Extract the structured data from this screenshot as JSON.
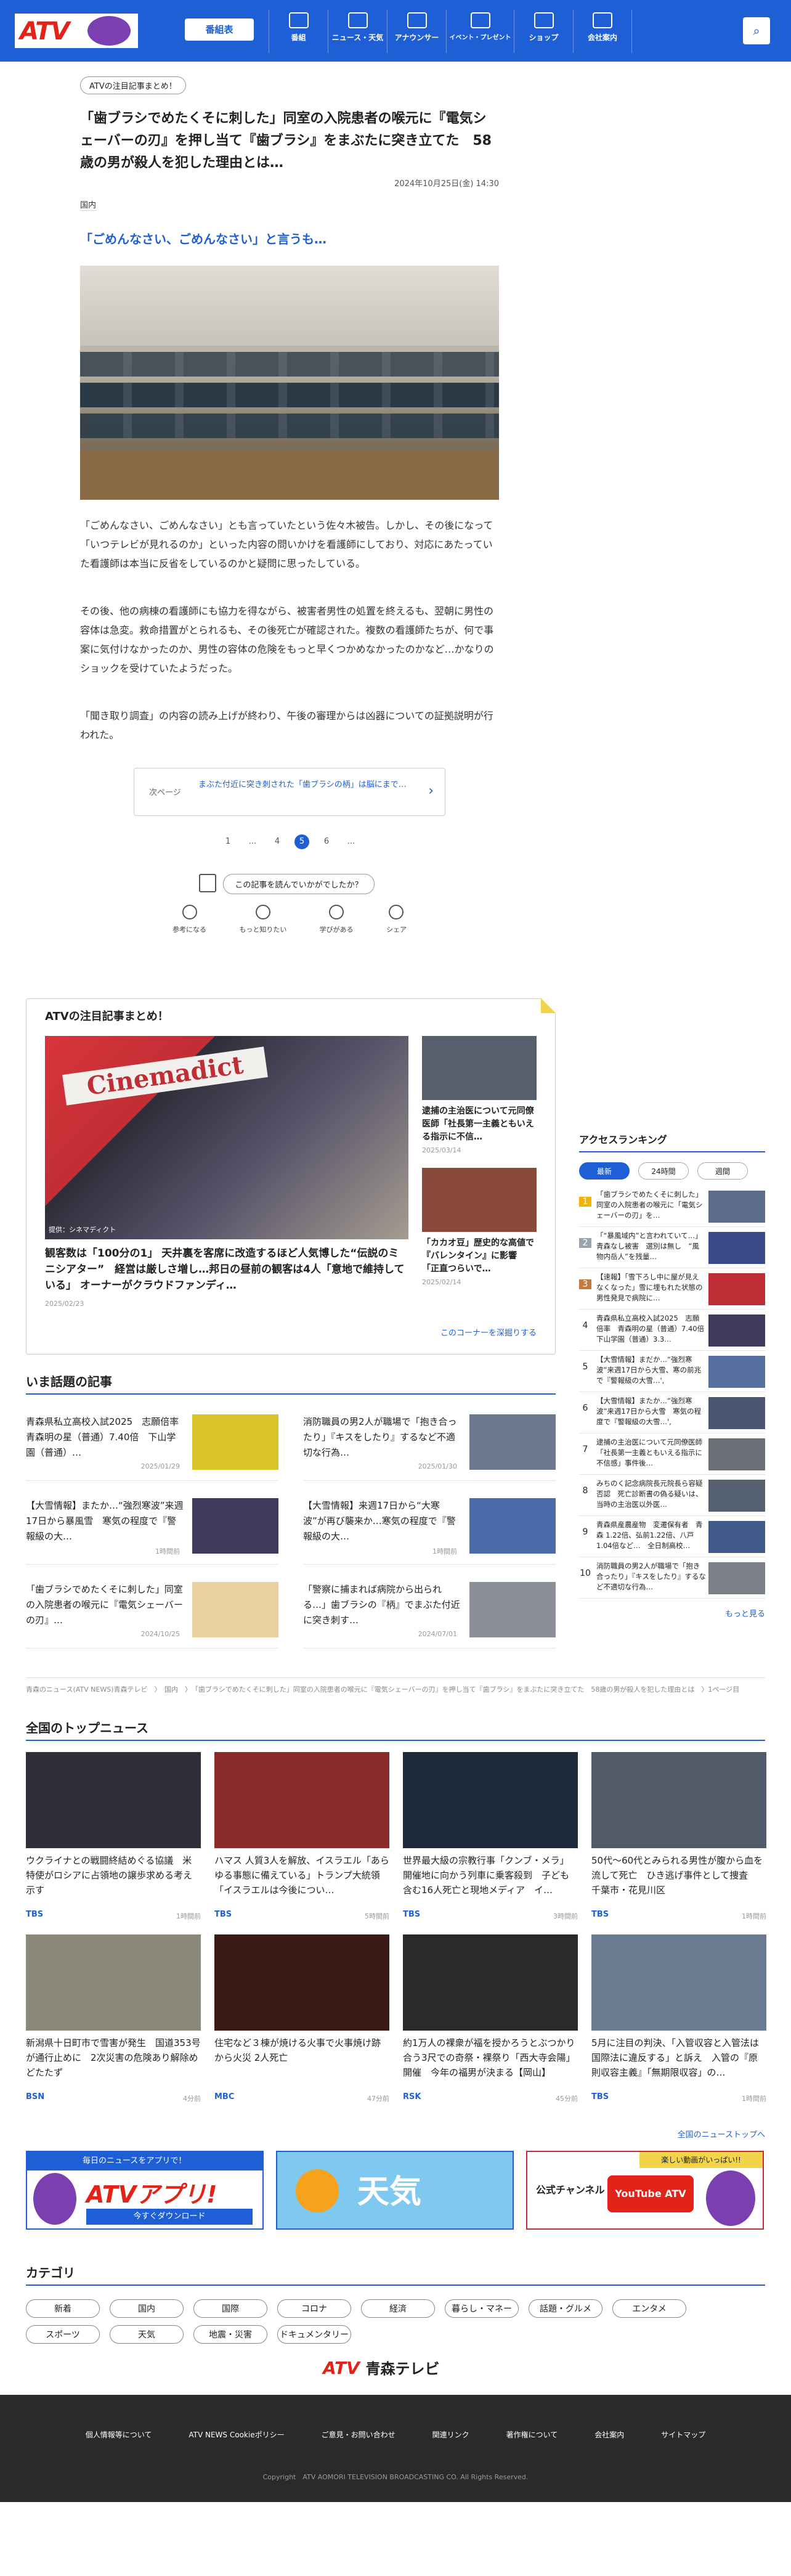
{
  "header": {
    "logo": "ATV",
    "program_label": "番組表",
    "nav": [
      "番組",
      "ニュース・天気",
      "アナウンサー",
      "イベント・プレゼント",
      "ショップ",
      "会社案内"
    ]
  },
  "article": {
    "tag": "ATVの注目記事まとめ！",
    "title": "「歯ブラシでめたくそに刺した」同室の入院患者の喉元に『電気シェーバーの刃』を押し当て『歯ブラシ』をまぶたに突き立てた　58歳の男が殺人を犯した理由とは…",
    "date": "2024年10月25日(金) 14:30",
    "category": "国内",
    "lead": "「ごめんなさい、ごめんなさい」と言うも…",
    "p1": "「ごめんなさい、ごめんなさい」とも言っていたという佐々木被告。しかし、その後になって「いつテレビが見れるのか」といった内容の問いかけを看護師にしており、対応にあたっていた看護師は本当に反省をしているのかと疑問に思ったしている。",
    "p2": "その後、他の病棟の看護師にも協力を得ながら、被害者男性の処置を終えるも、翌朝に男性の容体は急変。救命措置がとられるも、その後死亡が確認された。複数の看護師たちが、何で事案に気付けなかったのか、男性の容体の危険をもっと早くつかめなかったのかなど…かなりのショックを受けていたようだった。",
    "p3": "「聞き取り調査」の内容の読み上げが終わり、午後の審理からは凶器についての証拠説明が行われた。",
    "next_label": "次ページ",
    "next_title": "まぶた付近に突き刺された「歯ブラシの柄」は脳にまで…",
    "pages": [
      "1",
      "…",
      "4",
      "5",
      "6",
      "…"
    ],
    "question": "この記事を読んでいかがでしたか？",
    "reactions": [
      "参考になる",
      "もっと知りたい",
      "学びがある",
      "シェア"
    ]
  },
  "feature": {
    "title": "ATVの注目記事まとめ！",
    "big_caption": "提供：シネマディクト",
    "big_title": "観客数は「100分の1」 天井裏を客席に改造するほど人気博した“伝説のミニシアター”　経営は厳しさ増し…邦日の昼前の観客は4人「意地で維持している」 オーナーがクラウドファンディ…",
    "big_date": "2025/02/23",
    "side": [
      {
        "title": "逮捕の主治医について元同僚医師「社長第一主義ともいえる指示に不信…",
        "date": "2025/03/14"
      },
      {
        "title": "「カカオ豆」歴史的な高値で『バレンタイン』に影響 「正直つらいで…",
        "date": "2025/02/14"
      }
    ],
    "more": "このコーナーを深掘りする"
  },
  "ranking": {
    "title": "アクセスランキング",
    "tabs": [
      "最新",
      "24時間",
      "週間"
    ],
    "items": [
      "「歯ブラシでめたくそに刺した」同室の入院患者の喉元に「電気シェーバーの刃」を…",
      "「“暴風域内”と言われていて…」青森なし被害　選別は無し　“風物内岳人”を残量…",
      "【速報】「雪下ろし中に屋が見えなくなった」雪に埋もれた状態の男性発見で病院に…",
      "青森県私立高校入試2025　志願倍率　青森明の星（普通）7.40倍　下山学園（普通）3.3…",
      "【大雪情報】まだか…“強烈寒波”来週17日から大雪、寒の前兆で『警報級の大雪…',",
      "【大雪情報】またか…“強烈寒波”来週17日から大雪　寒気の程度で『警報級の大雪…',",
      "逮捕の主治医について元同僚医師「社長第一主義ともいえる指示に不信感」事件後…",
      "みちのく記念病院長元院長ら容疑否認　死亡診断書の偽る疑いは、当時の主治医以外医…",
      "青森県産農産物　変遷保有者　青森 1.22倍、弘前1.22倍、八戸1.04倍など…　全日制高校…",
      "消防職員の男2人が職場で「抱き合ったり」『キスをしたり』するなど不適切な行為…"
    ],
    "more": "もっと見る"
  },
  "topics": {
    "title": "いま話題の記事",
    "items": [
      {
        "title": "青森県私立高校入試2025　志願倍率　青森明の星（普通）7.40倍　下山学園（普通）…",
        "date": "2025/01/29"
      },
      {
        "title": "消防職員の男2人が職場で「抱き合ったり」『キスをしたり』するなど不適切な行為…",
        "date": "2025/01/30"
      },
      {
        "title": "【大雪情報】またか…“強烈寒波”来週17日から暴風雪　寒気の程度で『警報級の大…",
        "date": "1時間前"
      },
      {
        "title": "【大雪情報】来週17日から“大寒波”が再び襲来か…寒気の程度で『警報級の大…",
        "date": "1時間前"
      },
      {
        "title": "「歯ブラシでめたくそに刺した」同室の入院患者の喉元に『電気シェーバーの刃』…",
        "date": "2024/10/25"
      },
      {
        "title": "「警察に捕まれば病院から出られる…」歯ブラシの『柄』でまぶた付近に突き刺す…",
        "date": "2024/07/01"
      }
    ]
  },
  "breadcrumb": "青森のニュース(ATV NEWS)青森テレビ　〉　国内　〉　「歯ブラシでめたくそに刺した」同室の入院患者の喉元に『電気シェーバーの刃』を押し当て『歯ブラシ』をまぶたに突き立てた　58歳の男が殺人を犯した理由とは　〉1ページ目",
  "national": {
    "title": "全国のトップニュース",
    "items": [
      {
        "title": "ウクライナとの戦闘終結めぐる協議　米特使がロシアに占領地の譲歩求める考え示す",
        "src": "TBS",
        "date": "1時間前"
      },
      {
        "title": "ハマス 人質3人を解放、イスラエル「あらゆる事態に備えている」トランプ大統領「イスラエルは今後につい…",
        "src": "TBS",
        "date": "5時間前"
      },
      {
        "title": "世界最大級の宗教行事「クンブ・メラ」開催地に向かう列車に乗客殺到　子ども含む16人死亡と現地メディア　イ…",
        "src": "TBS",
        "date": "3時間前"
      },
      {
        "title": "50代～60代とみられる男性が腹から血を流して死亡　ひき逃げ事件として捜査　千葉市・花見川区",
        "src": "TBS",
        "date": "1時間前"
      },
      {
        "title": "新潟県十日町市で雪害が発生　国道353号が通行止めに　2次災害の危険あり解除めどたたず",
        "src": "BSN",
        "date": "4分前"
      },
      {
        "title": "住宅など３棟が焼ける火事で火事焼け跡から火災 2人死亡",
        "src": "MBC",
        "date": "47分前"
      },
      {
        "title": "約1万人の裸衆が福を授かろうとぶつかり合う3尺での奇祭・裸祭り「西大寺会陽」開催　今年の福男が決まる【岡山】",
        "src": "RSK",
        "date": "45分前"
      },
      {
        "title": "5月に注目の判決、「入管収容と入管法は国際法に違反する」と訴え　入管の『原則収容主義』「無期限収容」の…",
        "src": "TBS",
        "date": "1時間前"
      }
    ],
    "more": "全国のニューストップへ"
  },
  "banners": {
    "app_top": "毎日のニュースをアプリで！",
    "app": "ATVアプリ!",
    "app_dl": "今すぐダウンロード",
    "weather": "天気",
    "official": "公式チャンネル",
    "yt_top": "楽しい動画がいっぱい!!",
    "yt": "YouTube ATV"
  },
  "categories": {
    "title": "カテゴリ",
    "items": [
      "新着",
      "国内",
      "国際",
      "コロナ",
      "経済",
      "暮らし・マネー",
      "話題・グルメ",
      "エンタメ",
      "スポーツ",
      "天気",
      "地震・災害",
      "ドキュメンタリー"
    ]
  },
  "footer": {
    "logo": "ATV",
    "logo2": "青森テレビ",
    "links": [
      "個人情報等について",
      "ATV NEWS Cookieポリシー",
      "ご意見・お問い合わせ",
      "関連リンク",
      "著作権について",
      "会社案内",
      "サイトマップ"
    ],
    "copyright": "Copyright　ATV AOMORI TELEVISION BROADCASTING CO. All Rights Reserved."
  }
}
